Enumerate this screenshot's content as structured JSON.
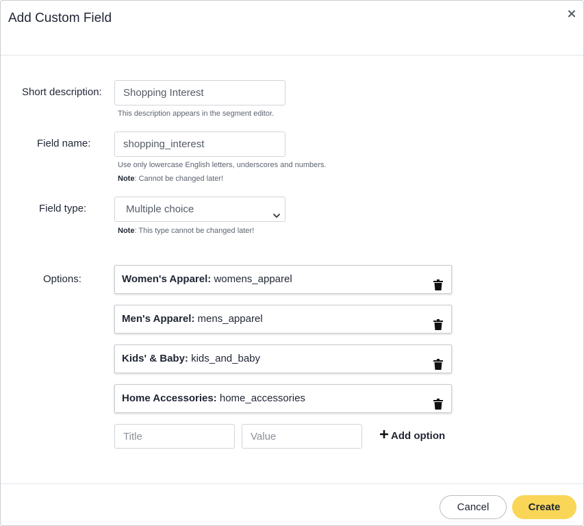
{
  "dialog": {
    "title": "Add Custom Field"
  },
  "form": {
    "short_description": {
      "label": "Short description:",
      "value": "Shopping Interest",
      "hint": "This description appears in the segment editor."
    },
    "field_name": {
      "label": "Field name:",
      "value": "shopping_interest",
      "hint": "Use only lowercase English letters, underscores and numbers.",
      "note_label": "Note",
      "note_text": ": Cannot be changed later!"
    },
    "field_type": {
      "label": "Field type:",
      "selected": "Multiple choice",
      "note_label": "Note",
      "note_text": ": This type cannot be changed later!"
    },
    "options": {
      "label": "Options:",
      "items": [
        {
          "title": "Women's Apparel:",
          "value": "womens_apparel"
        },
        {
          "title": "Men's Apparel:",
          "value": "mens_apparel"
        },
        {
          "title": "Kids' & Baby:",
          "value": "kids_and_baby"
        },
        {
          "title": "Home Accessories:",
          "value": "home_accessories"
        }
      ],
      "new_title_placeholder": "Title",
      "new_value_placeholder": "Value",
      "add_label": "Add option"
    }
  },
  "footer": {
    "cancel_label": "Cancel",
    "create_label": "Create"
  },
  "colors": {
    "primary_button": "#f9d657",
    "border": "#c9ccd2",
    "text": "#1f2533"
  },
  "icons": {
    "close": "close-icon",
    "trash": "trash-icon",
    "plus": "plus-icon",
    "chevron": "chevron-down-icon"
  }
}
